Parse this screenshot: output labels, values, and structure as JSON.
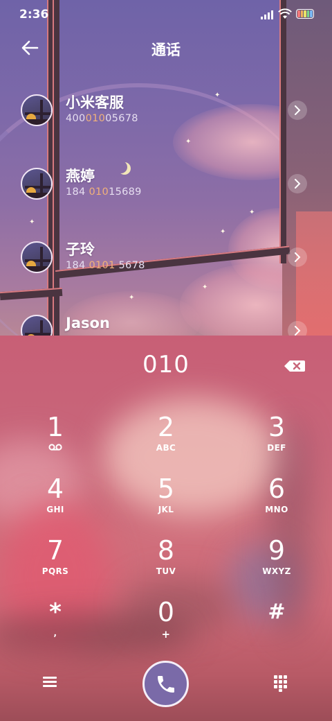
{
  "status_bar": {
    "time": "2:36"
  },
  "header": {
    "title": "通话"
  },
  "contacts": [
    {
      "name": "小米客服",
      "number_pre": "400",
      "number_hl": "010",
      "number_post": "05678"
    },
    {
      "name": "燕婷",
      "number_pre": "184 ",
      "number_hl": "010",
      "number_post": "15689"
    },
    {
      "name": "子玲",
      "number_pre": "184 ",
      "number_hl": "0101",
      "number_post": " 5678"
    },
    {
      "name": "Jason",
      "number_pre": "",
      "number_hl": "",
      "number_post": ""
    }
  ],
  "dialer": {
    "input": "010",
    "keys": [
      {
        "num": "1",
        "sub": ""
      },
      {
        "num": "2",
        "sub": "ABC"
      },
      {
        "num": "3",
        "sub": "DEF"
      },
      {
        "num": "4",
        "sub": "GHI"
      },
      {
        "num": "5",
        "sub": "JKL"
      },
      {
        "num": "6",
        "sub": "MNO"
      },
      {
        "num": "7",
        "sub": "PQRS"
      },
      {
        "num": "8",
        "sub": "TUV"
      },
      {
        "num": "9",
        "sub": "WXYZ"
      },
      {
        "num": "*",
        "sub": ","
      },
      {
        "num": "0",
        "sub": "+"
      },
      {
        "num": "#",
        "sub": ""
      }
    ]
  },
  "colors": {
    "highlight": "#f2b27a",
    "call_button": "#7a6aa8",
    "dialer_bg": "#c8667a"
  },
  "icons": {
    "back": "arrow-left-icon",
    "detail": "chevron-right-icon",
    "backspace": "backspace-icon",
    "voicemail": "voicemail-icon",
    "menu": "menu-icon",
    "call": "phone-icon",
    "dialpad": "dialpad-icon"
  }
}
